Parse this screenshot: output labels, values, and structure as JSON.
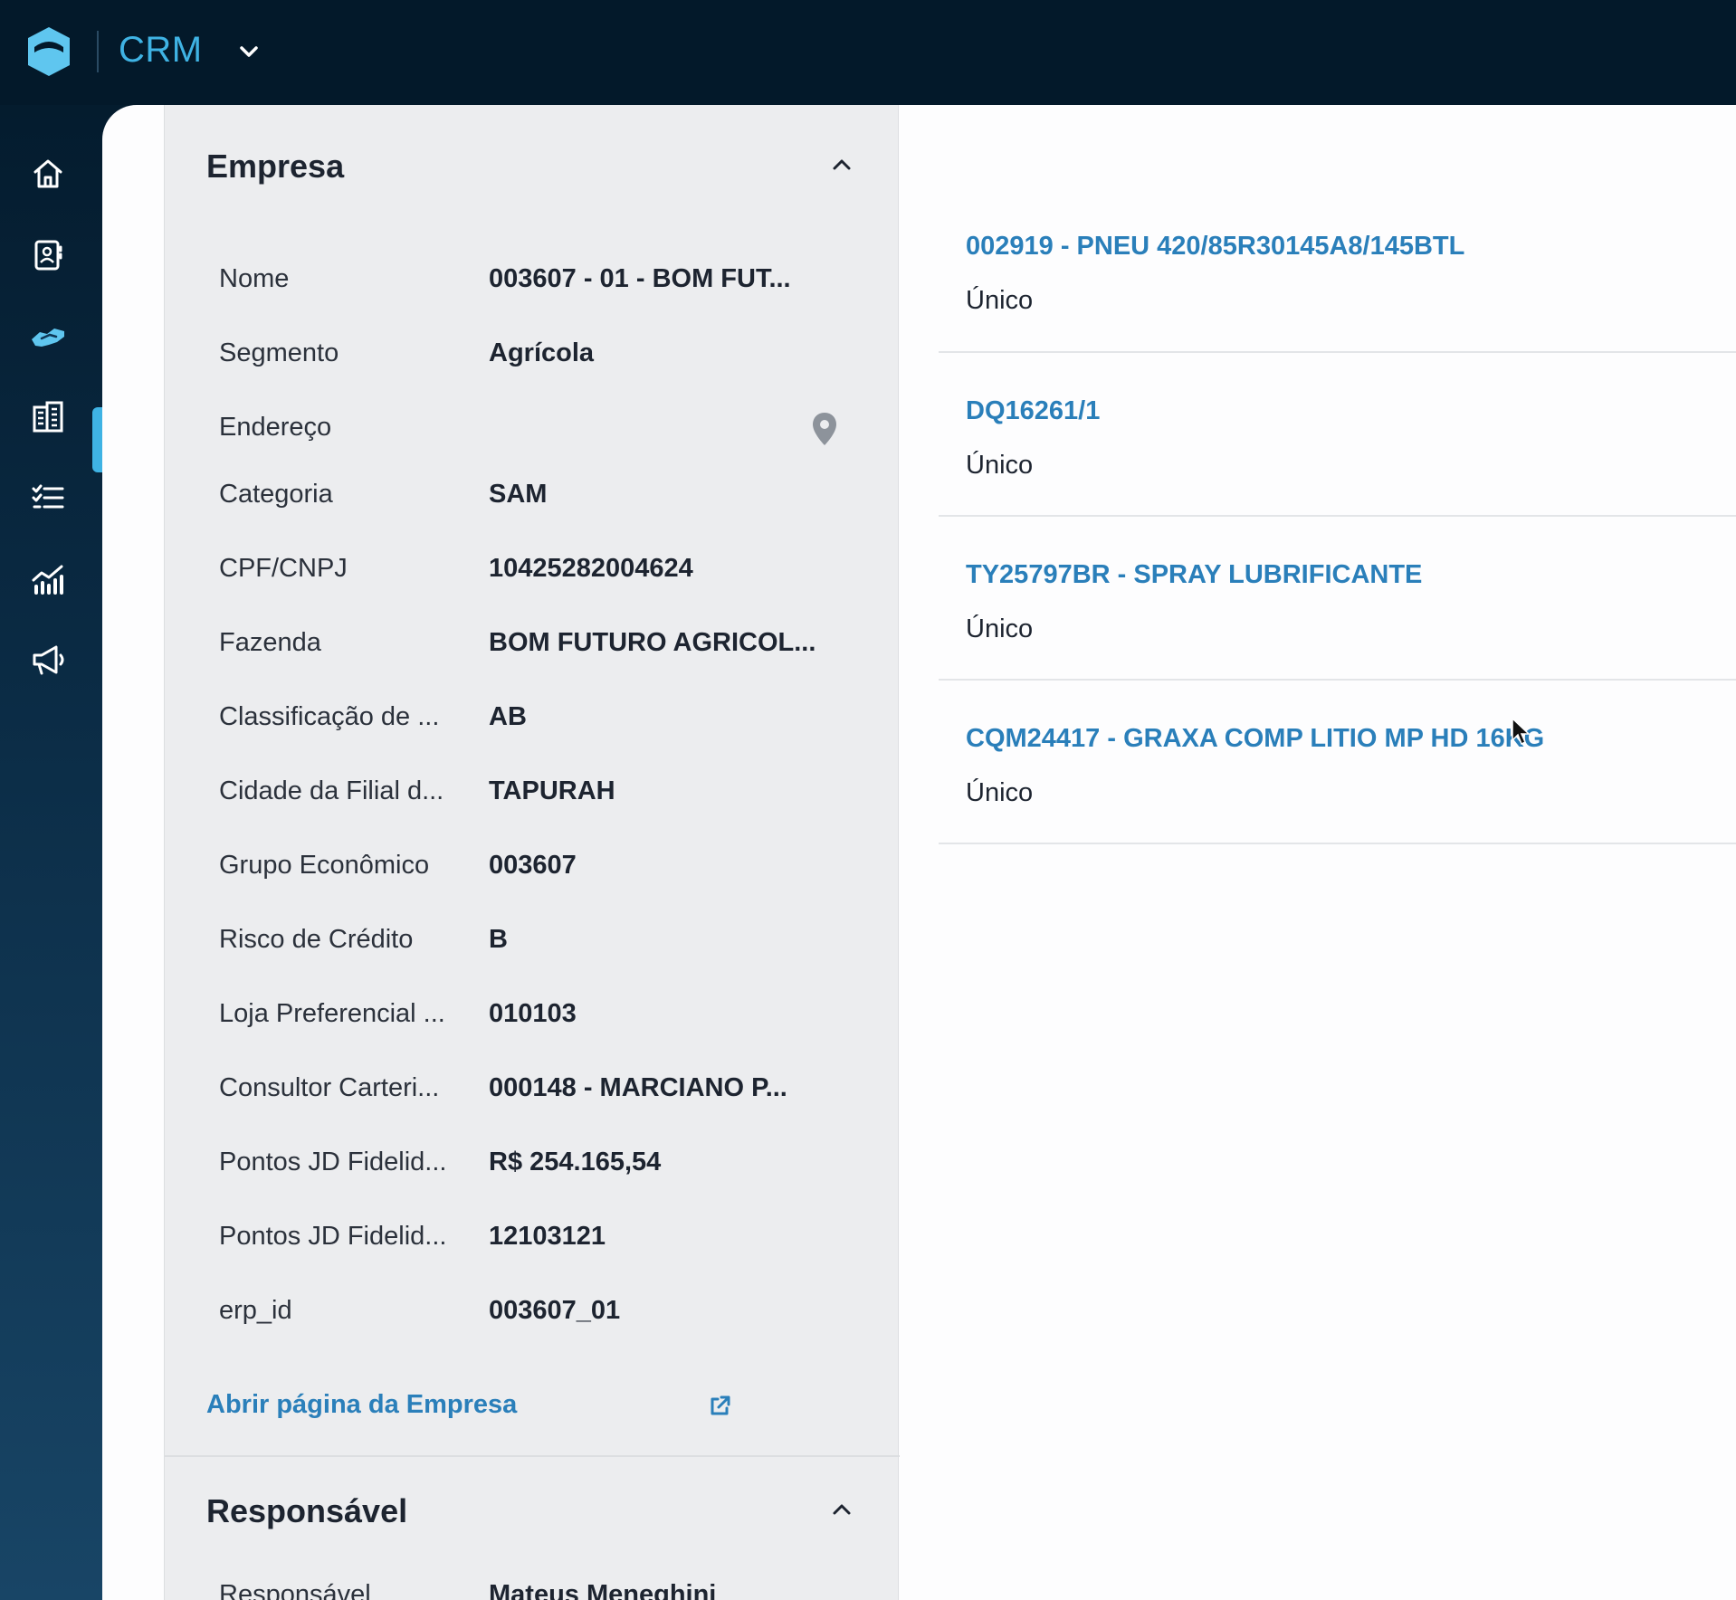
{
  "app": {
    "title": "CRM"
  },
  "sidebar": {
    "items": [
      {
        "icon": "home-icon"
      },
      {
        "icon": "contacts-icon"
      },
      {
        "icon": "handshake-icon",
        "active": true
      },
      {
        "icon": "buildings-icon"
      },
      {
        "icon": "tasks-list-icon"
      },
      {
        "icon": "analytics-icon"
      },
      {
        "icon": "megaphone-icon"
      }
    ]
  },
  "empresa": {
    "title": "Empresa",
    "fields": [
      {
        "label": "Nome",
        "value": "003607 - 01 - BOM FUT..."
      },
      {
        "label": "Segmento",
        "value": "Agrícola"
      },
      {
        "label": "Endereço",
        "value": ""
      },
      {
        "label": "Categoria",
        "value": "SAM"
      },
      {
        "label": "CPF/CNPJ",
        "value": "10425282004624"
      },
      {
        "label": "Fazenda",
        "value": "BOM FUTURO AGRICOL..."
      },
      {
        "label": "Classificação de ...",
        "value": "AB"
      },
      {
        "label": "Cidade da Filial d...",
        "value": "TAPURAH"
      },
      {
        "label": "Grupo Econômico",
        "value": "003607"
      },
      {
        "label": "Risco de Crédito",
        "value": "B"
      },
      {
        "label": "Loja Preferencial ...",
        "value": "010103"
      },
      {
        "label": "Consultor Carteri...",
        "value": "000148 - MARCIANO P..."
      },
      {
        "label": "Pontos JD Fidelid...",
        "value": "R$ 254.165,54"
      },
      {
        "label": "Pontos JD Fidelid...",
        "value": "12103121"
      },
      {
        "label": "erp_id",
        "value": "003607_01"
      }
    ],
    "link_label": "Abrir página da Empresa"
  },
  "responsavel": {
    "title": "Responsável",
    "fields": [
      {
        "label": "Responsável",
        "value": "Mateus Meneghini"
      }
    ]
  },
  "products": [
    {
      "name": "002919 - PNEU 420/85R30145A8/145BTL",
      "sub": "Único"
    },
    {
      "name": "DQ16261/1",
      "sub": "Único"
    },
    {
      "name": "TY25797BR - SPRAY LUBRIFICANTE",
      "sub": "Único"
    },
    {
      "name": "CQM24417 - GRAXA COMP LITIO MP HD 16KG",
      "sub": "Único"
    }
  ],
  "colors": {
    "accent": "#3fb3e4",
    "link": "#2a7fba",
    "topbar": "#03192a"
  }
}
